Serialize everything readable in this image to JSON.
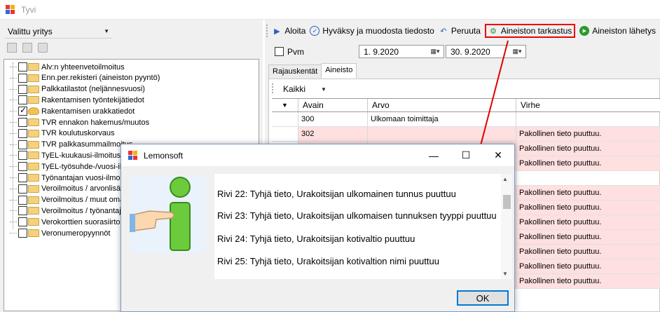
{
  "window": {
    "title": "Tyvi"
  },
  "left": {
    "company": "Valittu yritys",
    "tree_items": [
      {
        "label": "Alv:n yhteenvetoilmoitus",
        "checked": false
      },
      {
        "label": "Enn.per.rekisteri (aineiston pyyntö)",
        "checked": false
      },
      {
        "label": "Palkkatilastot (neljännesvuosi)",
        "checked": false
      },
      {
        "label": "Rakentamisen työntekijätiedot",
        "checked": false
      },
      {
        "label": "Rakentamisen urakkatiedot",
        "checked": true
      },
      {
        "label": "TVR ennakon hakemus/muutos",
        "checked": false
      },
      {
        "label": "TVR koulutuskorvaus",
        "checked": false
      },
      {
        "label": "TVR palkkasummailmoitus",
        "checked": false
      },
      {
        "label": "TyEL-kuukausi-ilmoitus",
        "checked": false
      },
      {
        "label": "TyEL-työsuhde-/vuosi-ilm",
        "checked": false
      },
      {
        "label": "Työnantajan vuosi-ilmoit",
        "checked": false
      },
      {
        "label": "Veroilmoitus / arvonlisäv",
        "checked": false
      },
      {
        "label": "Veroilmoitus / muut oma",
        "checked": false
      },
      {
        "label": "Veroilmoitus / työnantaja",
        "checked": false
      },
      {
        "label": "Verokorttien suorasiirto (",
        "checked": false
      },
      {
        "label": "Veronumeropyynnöt",
        "checked": false
      }
    ]
  },
  "toolbar": {
    "start": "Aloita",
    "approve": "Hyväksy ja muodosta tiedosto",
    "cancel": "Peruuta",
    "check": "Aineiston tarkastus",
    "send": "Aineiston lähetys"
  },
  "date_filter": {
    "label": "Pvm",
    "from": "1. 9.2020",
    "to": "30. 9.2020"
  },
  "tabs": [
    "Rajauskentät",
    "Aineisto"
  ],
  "filter": {
    "value": "Kaikki"
  },
  "grid": {
    "headers": [
      "Avain",
      "Arvo",
      "Virhe"
    ],
    "rows": [
      {
        "avain": "300",
        "arvo": "Ulkomaan toimittaja",
        "virhe": "",
        "error": false
      },
      {
        "avain": "302",
        "arvo": "",
        "virhe": "Pakollinen tieto puuttuu.",
        "error": true
      },
      {
        "avain": "",
        "arvo": "",
        "virhe": "Pakollinen tieto puuttuu.",
        "error": true
      },
      {
        "avain": "",
        "arvo": "",
        "virhe": "Pakollinen tieto puuttuu.",
        "error": true
      },
      {
        "avain": "",
        "arvo": "",
        "virhe": "",
        "error": false
      },
      {
        "avain": "",
        "arvo": "",
        "virhe": "Pakollinen tieto puuttuu.",
        "error": true
      },
      {
        "avain": "",
        "arvo": "",
        "virhe": "Pakollinen tieto puuttuu.",
        "error": true
      },
      {
        "avain": "",
        "arvo": "",
        "virhe": "Pakollinen tieto puuttuu.",
        "error": true
      },
      {
        "avain": "",
        "arvo": "",
        "virhe": "Pakollinen tieto puuttuu.",
        "error": true
      },
      {
        "avain": "",
        "arvo": "",
        "virhe": "Pakollinen tieto puuttuu.",
        "error": true
      },
      {
        "avain": "",
        "arvo": "",
        "virhe": "Pakollinen tieto puuttuu.",
        "error": true
      },
      {
        "avain": "",
        "arvo": "",
        "virhe": "Pakollinen tieto puuttuu.",
        "error": true
      }
    ]
  },
  "dialog": {
    "title": "Lemonsoft",
    "messages": [
      "Rivi 22: Tyhjä tieto, Urakoitsijan ulkomainen tunnus puuttuu",
      "Rivi 23: Tyhjä tieto, Urakoitsijan ulkomaisen tunnuksen tyyppi puuttuu",
      "Rivi 24: Tyhjä tieto, Urakoitsijan kotivaltio puuttuu",
      "Rivi 25: Tyhjä tieto, Urakoitsijan kotivaltion nimi puuttuu"
    ],
    "ok": "OK"
  },
  "colors": {
    "highlight": "#e00000",
    "error_row": "#ffe0e0",
    "accent": "#0078d7"
  }
}
